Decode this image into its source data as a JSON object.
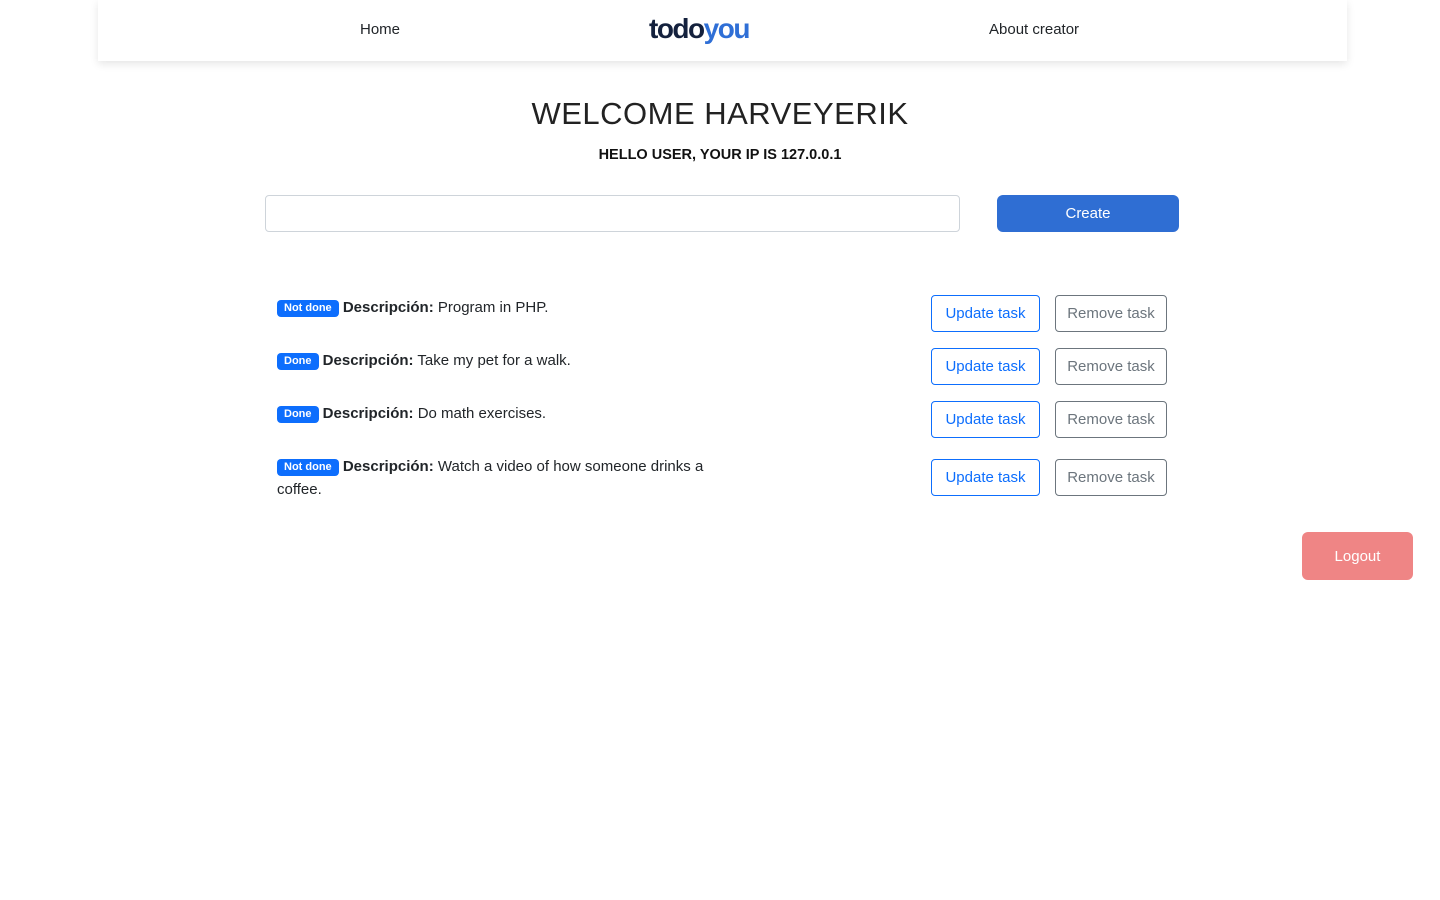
{
  "nav": {
    "home_label": "Home",
    "about_label": "About creator",
    "logo_part1": "todo",
    "logo_part2": "you"
  },
  "welcome_title": "WELCOME HARVEYERIK",
  "ip_message": "HELLO USER, YOUR IP IS 127.0.0.1",
  "create_form": {
    "input_value": "",
    "input_placeholder": "",
    "create_label": "Create"
  },
  "tasks": [
    {
      "status": "Not done",
      "desc_label": "Descripción:",
      "description": " Program in PHP.",
      "update_label": "Update task",
      "remove_label": "Remove task"
    },
    {
      "status": "Done",
      "desc_label": "Descripción:",
      "description": " Take my pet for a walk.",
      "update_label": "Update task",
      "remove_label": "Remove task"
    },
    {
      "status": "Done",
      "desc_label": "Descripción:",
      "description": " Do math exercises.",
      "update_label": "Update task",
      "remove_label": "Remove task"
    },
    {
      "status": "Not done",
      "desc_label": "Descripción:",
      "description": " Watch a video of how someone drinks a coffee.",
      "update_label": "Update task",
      "remove_label": "Remove task"
    }
  ],
  "logout_label": "Logout",
  "colors": {
    "brand_dark": "#14213d",
    "brand_blue": "#2f6fd6",
    "primary": "#0d6efd",
    "secondary": "#6c757d",
    "logout": "#ef8585"
  }
}
